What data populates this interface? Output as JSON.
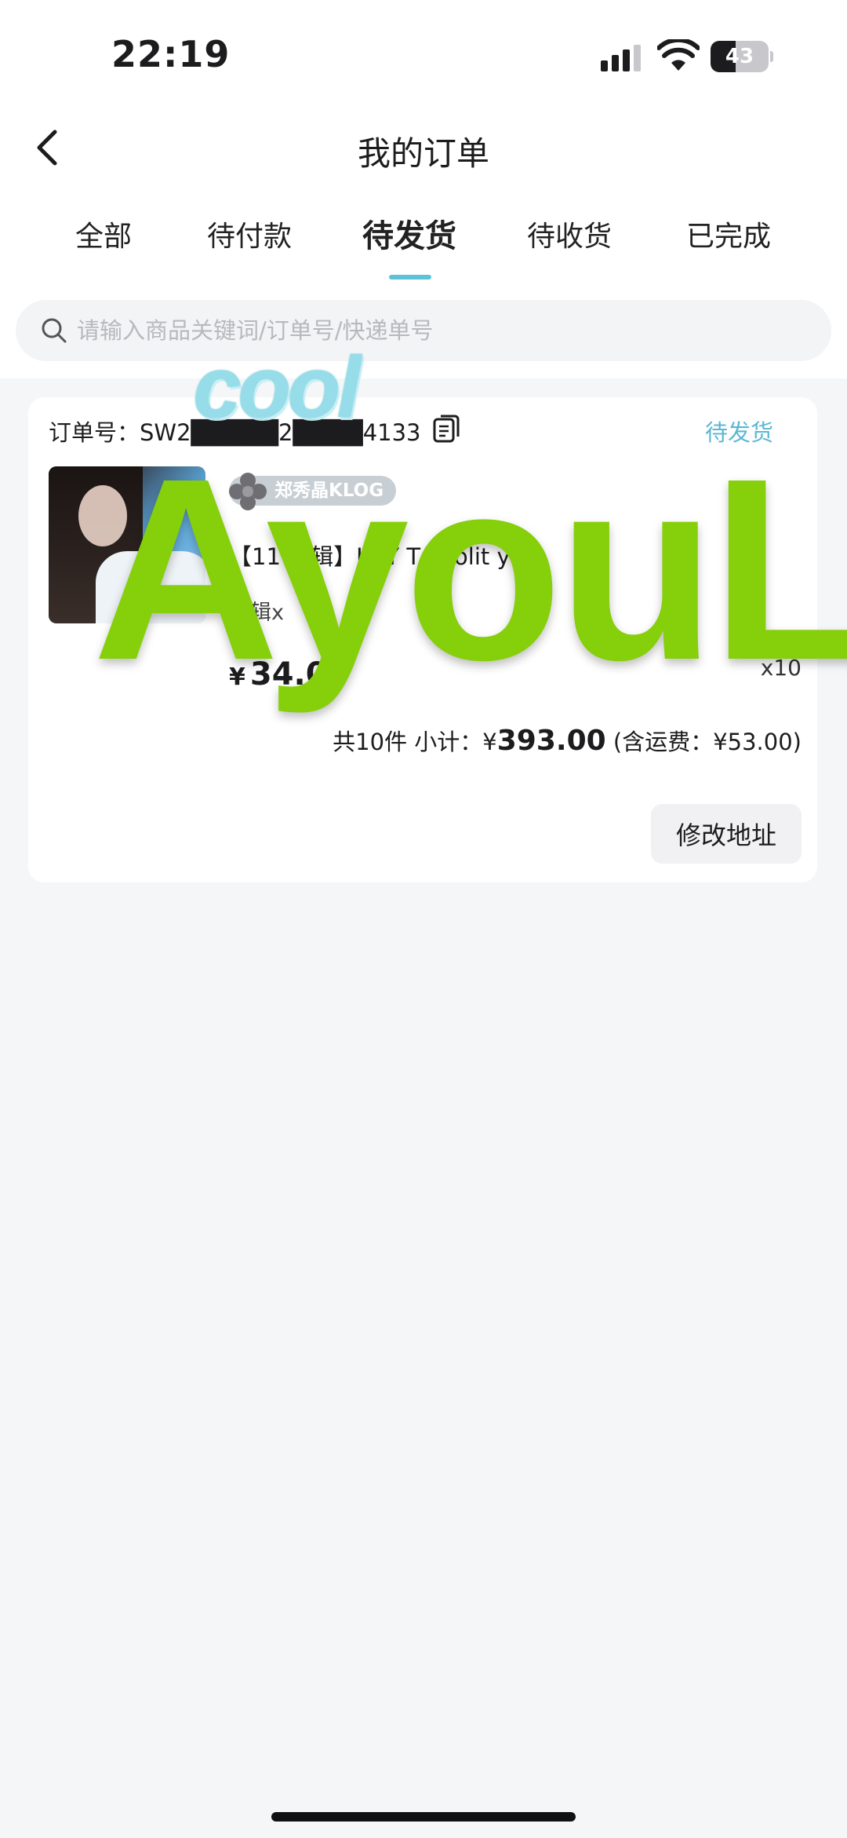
{
  "status_bar": {
    "time": "22:19",
    "battery": "43"
  },
  "header": {
    "title": "我的订单"
  },
  "tabs": [
    {
      "label": "全部"
    },
    {
      "label": "待付款"
    },
    {
      "label": "待发货",
      "active": true
    },
    {
      "label": "待收货"
    },
    {
      "label": "已完成"
    }
  ],
  "search": {
    "placeholder": "请输入商品关键词/订单号/快递单号"
  },
  "order": {
    "order_no": "订单号：SW2█████2████4133",
    "status": "待发货",
    "shop": "郑秀晶KLOG",
    "product_name": "【11 专辑】KRY TAL olit y",
    "spec": "专辑x",
    "price_symbol": "¥",
    "price": "34.00",
    "quantity": "x10",
    "summary_prefix": "共10件 小计：¥",
    "total": "393.00",
    "shipping": " (含运费：¥53.00)",
    "action_button": "修改地址"
  },
  "watermark": {
    "main": "AyouL",
    "small": "cool"
  },
  "colors": {
    "accent": "#5bc3d8",
    "watermark_green": "#86cf0b"
  }
}
